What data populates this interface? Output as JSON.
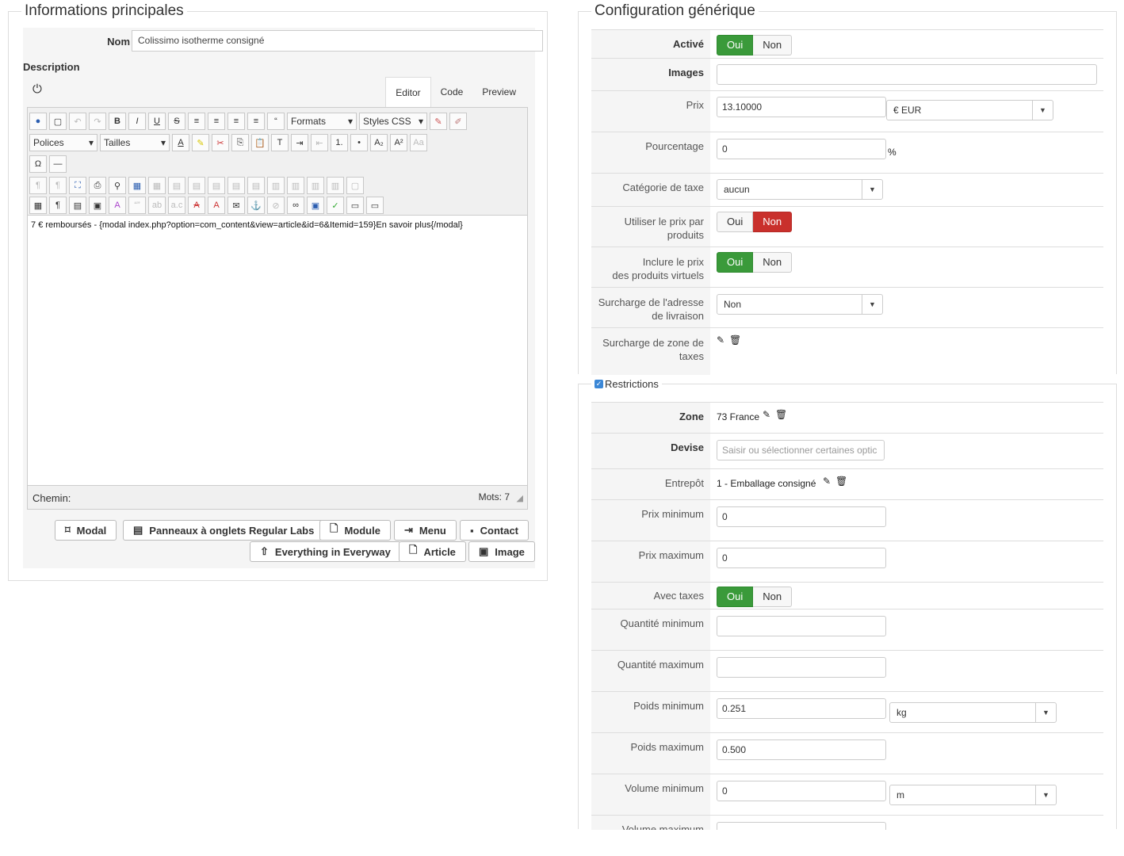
{
  "left": {
    "legend": "Informations principales",
    "nom_label": "Nom",
    "nom_value": "Colissimo isotherme consigné",
    "description_label": "Description",
    "tabs": [
      "Editor",
      "Code",
      "Preview"
    ],
    "toolbar": {
      "formats": "Formats",
      "styles": "Styles CSS",
      "polices": "Polices",
      "tailles": "Tailles"
    },
    "content": "7 € remboursés - {modal index.php?option=com_content&view=article&id=6&Itemid=159}En savoir plus{/modal}",
    "status": {
      "path_label": "Chemin:",
      "words": "Mots: 7"
    },
    "buttons": [
      "Modal",
      "Panneaux à onglets Regular Labs",
      "Module",
      "Menu",
      "Contact",
      "Everything in Everyway",
      "Article",
      "Image"
    ]
  },
  "generic": {
    "legend": "Configuration générique",
    "active_label": "Activé",
    "images_label": "Images",
    "price_label": "Prix",
    "price_value": "13.10000",
    "currency": "€ EUR",
    "percent_label": "Pourcentage",
    "percent_value": "0",
    "percent_sign": "%",
    "tax_label": "Catégorie de taxe",
    "tax_value": "aucun",
    "per_product_label_1": "Utiliser le prix par",
    "per_product_label_2": "produits",
    "virtual_label_1": "Inclure le prix",
    "virtual_label_2": "des produits virtuels",
    "address_label_1": "Surcharge de l'adresse",
    "address_label_2": "de livraison",
    "address_value": "Non",
    "zone_override_label_1": "Surcharge de zone de",
    "zone_override_label_2": "taxes",
    "oui": "Oui",
    "non": "Non"
  },
  "restrictions": {
    "legend": "Restrictions",
    "zone_label": "Zone",
    "zone_value": "73 France",
    "devise_label": "Devise",
    "devise_placeholder": "Saisir ou sélectionner certaines optic",
    "entrepot_label": "Entrepôt",
    "entrepot_value": "1 - Emballage consigné",
    "prix_min_label": "Prix minimum",
    "prix_min_value": "0",
    "prix_max_label": "Prix maximum",
    "prix_max_value": "0",
    "taxes_label": "Avec taxes",
    "qte_min_label": "Quantité minimum",
    "qte_max_label": "Quantité maximum",
    "poids_min_label": "Poids minimum",
    "poids_min_value": "0.251",
    "poids_unit": "kg",
    "poids_max_label": "Poids maximum",
    "poids_max_value": "0.500",
    "vol_min_label": "Volume minimum",
    "vol_min_value": "0",
    "vol_unit": "m",
    "vol_max_label": "Volume maximum"
  }
}
